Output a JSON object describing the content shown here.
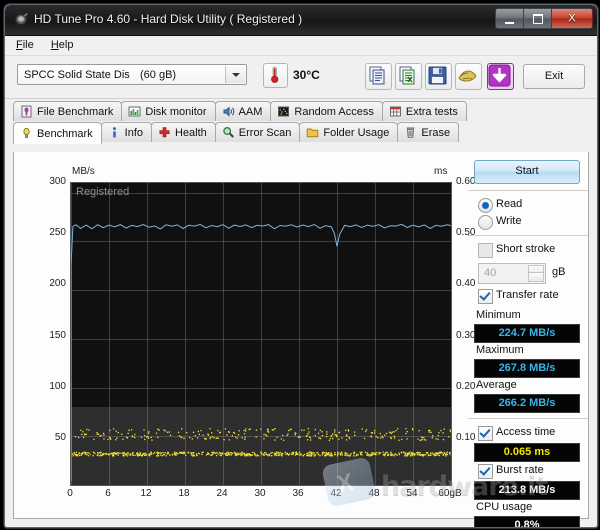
{
  "window": {
    "title": "HD Tune Pro 4.60 - Hard Disk Utility (  Registered )",
    "minimize_label": "",
    "maximize_label": "",
    "close_label": "X"
  },
  "menu": {
    "items": [
      "File",
      "Help"
    ]
  },
  "toolbar": {
    "drive_name": "SPCC Solid State Dis",
    "drive_size": "(60 gB)",
    "temperature": "30°C",
    "exit_label": "Exit",
    "buttons": [
      "copy-icon",
      "copy-excel-icon",
      "save-icon",
      "gold-icon",
      "download-icon"
    ]
  },
  "tabs": {
    "row1": [
      {
        "label": "File Benchmark",
        "icon": "file-benchmark-icon",
        "active": false
      },
      {
        "label": "Disk monitor",
        "icon": "disk-monitor-icon",
        "active": false
      },
      {
        "label": "AAM",
        "icon": "aam-icon",
        "active": false
      },
      {
        "label": "Random Access",
        "icon": "random-access-icon",
        "active": false
      },
      {
        "label": "Extra tests",
        "icon": "extra-tests-icon",
        "active": false
      }
    ],
    "row2": [
      {
        "label": "Benchmark",
        "icon": "benchmark-icon",
        "active": true
      },
      {
        "label": "Info",
        "icon": "info-icon",
        "active": false
      },
      {
        "label": "Health",
        "icon": "health-icon",
        "active": false
      },
      {
        "label": "Error Scan",
        "icon": "error-scan-icon",
        "active": false
      },
      {
        "label": "Folder Usage",
        "icon": "folder-usage-icon",
        "active": false
      },
      {
        "label": "Erase",
        "icon": "erase-icon",
        "active": false
      }
    ]
  },
  "controls": {
    "start_label": "Start",
    "read_label": "Read",
    "write_label": "Write",
    "read_selected": true,
    "write_selected": false,
    "short_stroke_label": "Short stroke",
    "short_stroke_checked": false,
    "short_stroke_value": "40",
    "short_stroke_unit": "gB",
    "transfer_rate_label": "Transfer rate",
    "transfer_rate_checked": true,
    "minimum_label": "Minimum",
    "minimum_value": "224.7 MB/s",
    "maximum_label": "Maximum",
    "maximum_value": "267.8 MB/s",
    "average_label": "Average",
    "average_value": "266.2 MB/s",
    "access_time_label": "Access time",
    "access_time_checked": true,
    "access_time_value": "0.065 ms",
    "burst_rate_label": "Burst rate",
    "burst_rate_checked": true,
    "burst_rate_value": "213.8 MB/s",
    "cpu_usage_label": "CPU usage",
    "cpu_usage_value": "0.8%"
  },
  "watermark": {
    "brand": "hardware.it",
    "badge": "X"
  },
  "chart_data": {
    "type": "line",
    "title": "",
    "graph_watermark": "Registered",
    "xlabel": "",
    "x_unit_label": "60gB",
    "ylabel": "MB/s",
    "y2label": "ms",
    "xlim": [
      0,
      60
    ],
    "ylim": [
      0,
      310
    ],
    "y2lim": [
      0,
      0.62
    ],
    "grid": true,
    "xticks": [
      "0",
      "6",
      "12",
      "18",
      "24",
      "30",
      "36",
      "42",
      "48",
      "54",
      "60gB"
    ],
    "xtick_values": [
      0,
      6,
      12,
      18,
      24,
      30,
      36,
      42,
      48,
      54,
      60
    ],
    "yticks": [
      "300",
      "250",
      "200",
      "150",
      "100",
      "50"
    ],
    "ytick_values": [
      300,
      250,
      200,
      150,
      100,
      50
    ],
    "y2ticks": [
      "0.60",
      "0.50",
      "0.40",
      "0.30",
      "0.20",
      "0.10"
    ],
    "y2tick_values": [
      0.6,
      0.5,
      0.4,
      0.3,
      0.2,
      0.1
    ],
    "series": [
      {
        "name": "Transfer rate",
        "axis": "left",
        "color": "#7fb3da",
        "render": "line",
        "x": [
          0.0,
          0.3,
          0.8,
          1.5,
          2.4,
          3.3,
          4.2,
          5.1,
          6.0,
          6.9,
          7.8,
          8.7,
          9.6,
          10.5,
          11.4,
          12.3,
          13.2,
          14.1,
          15.0,
          15.9,
          16.8,
          17.7,
          18.6,
          19.5,
          20.4,
          21.3,
          22.2,
          23.1,
          24.0,
          24.9,
          25.8,
          26.7,
          27.6,
          28.5,
          29.4,
          30.3,
          31.2,
          32.1,
          33.0,
          33.9,
          34.8,
          35.7,
          36.6,
          37.5,
          38.4,
          39.3,
          40.2,
          41.1,
          41.6,
          42.0,
          42.4,
          43.2,
          44.1,
          45.0,
          45.9,
          46.8,
          47.7,
          48.6,
          49.5,
          50.4,
          51.3,
          52.2,
          53.1,
          54.0,
          54.9,
          55.8,
          56.7,
          57.6,
          58.5,
          59.4,
          60.0
        ],
        "y": [
          224.7,
          265.5,
          267.0,
          263.4,
          266.8,
          263.0,
          267.2,
          264.1,
          266.9,
          265.0,
          267.3,
          263.8,
          266.5,
          265.2,
          267.4,
          264.6,
          266.0,
          262.8,
          267.1,
          265.6,
          267.0,
          263.2,
          266.7,
          265.8,
          267.5,
          264.0,
          266.3,
          265.1,
          267.2,
          263.5,
          266.8,
          265.4,
          267.0,
          264.2,
          266.6,
          265.9,
          267.3,
          263.0,
          266.4,
          265.7,
          267.1,
          264.8,
          266.9,
          265.3,
          267.4,
          263.6,
          266.2,
          265.0,
          258.0,
          245.0,
          257.0,
          266.5,
          265.2,
          267.0,
          264.4,
          266.8,
          265.5,
          267.2,
          263.9,
          266.1,
          265.8,
          267.6,
          264.3,
          266.7,
          265.0,
          267.0,
          263.4,
          266.5,
          265.6,
          267.1,
          266.2
        ]
      },
      {
        "name": "Access time (upper scatter)",
        "axis": "right",
        "color": "#efe13a",
        "render": "scatter",
        "approx_value": 0.105,
        "spread": 0.012,
        "point_count": 260,
        "x_range": [
          0,
          60
        ]
      },
      {
        "name": "Access time (dense band)",
        "axis": "right",
        "color": "#efe13a",
        "render": "scatter",
        "approx_value": 0.065,
        "spread": 0.004,
        "point_count": 620,
        "x_range": [
          0,
          60
        ]
      }
    ]
  }
}
